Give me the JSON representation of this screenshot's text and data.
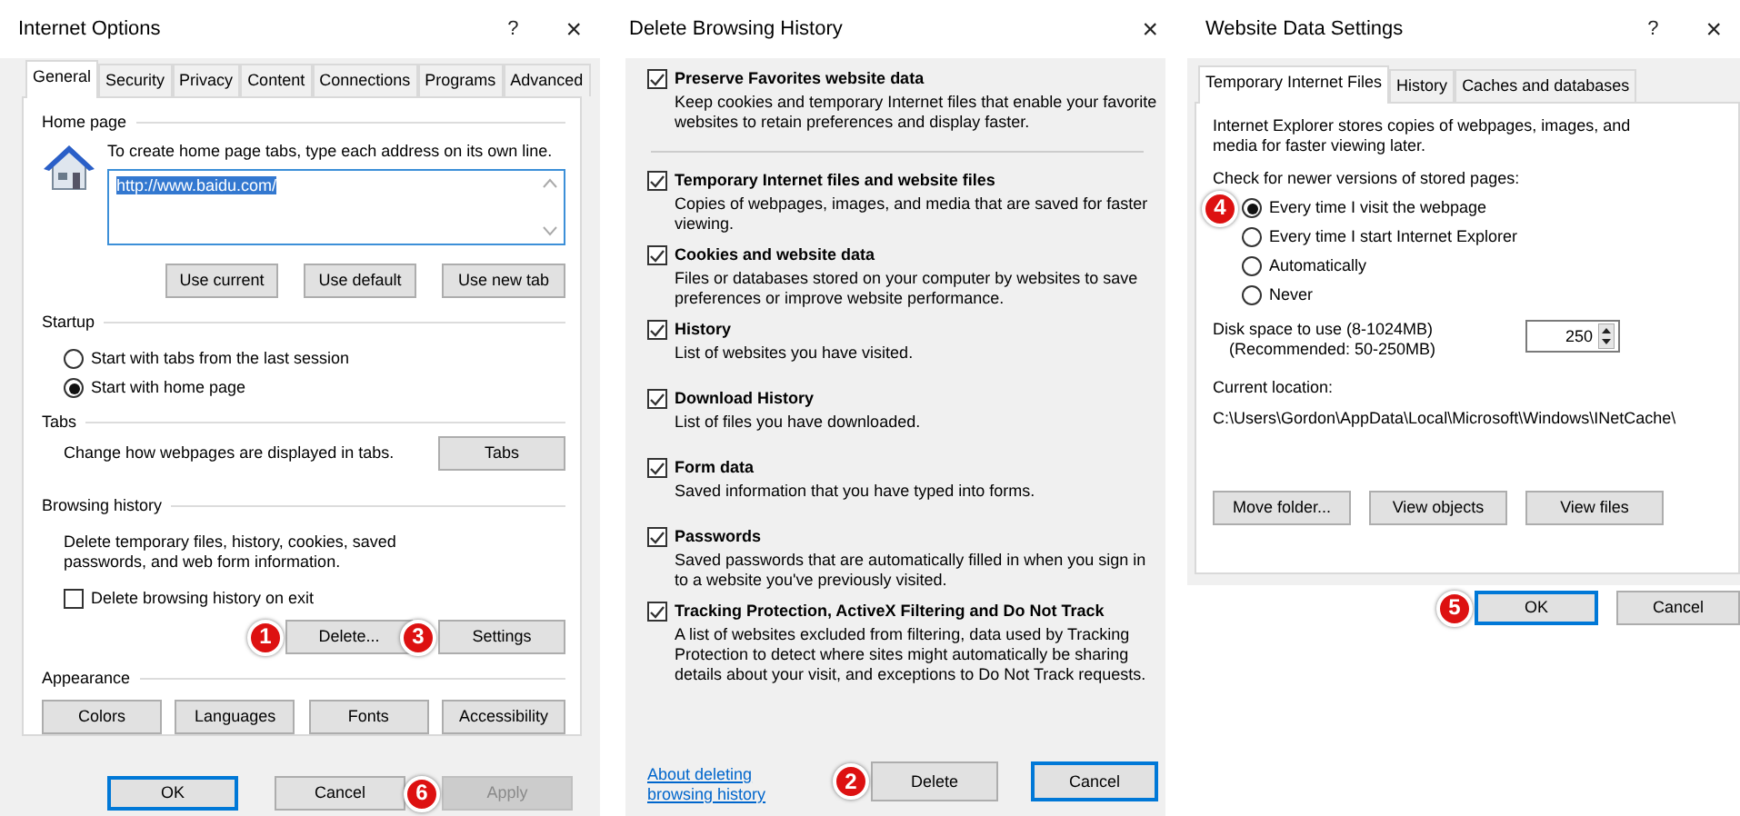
{
  "internet_options": {
    "title": "Internet Options",
    "help": "?",
    "close": "×",
    "tabs": [
      {
        "label": "General",
        "selected": true
      },
      {
        "label": "Security",
        "selected": false
      },
      {
        "label": "Privacy",
        "selected": false
      },
      {
        "label": "Content",
        "selected": false
      },
      {
        "label": "Connections",
        "selected": false
      },
      {
        "label": "Programs",
        "selected": false
      },
      {
        "label": "Advanced",
        "selected": false
      }
    ],
    "home_page": {
      "heading": "Home page",
      "instruction": "To create home page tabs, type each address on its own line.",
      "address": "http://www.baidu.com/",
      "buttons": [
        "Use current",
        "Use default",
        "Use new tab"
      ]
    },
    "startup": {
      "heading": "Startup",
      "options": [
        {
          "label": "Start with tabs from the last session",
          "selected": false
        },
        {
          "label": "Start with home page",
          "selected": true
        }
      ]
    },
    "tabs_section": {
      "heading": "Tabs",
      "description": "Change how webpages are displayed in tabs.",
      "button": "Tabs"
    },
    "browsing_history": {
      "heading": "Browsing history",
      "description": "Delete temporary files, history, cookies, saved passwords, and web form information.",
      "checkbox": {
        "label": "Delete browsing history on exit",
        "checked": false
      },
      "buttons": [
        {
          "label": "Delete...",
          "step": "1"
        },
        {
          "label": "Settings",
          "step": "3"
        }
      ]
    },
    "appearance": {
      "heading": "Appearance",
      "buttons": [
        "Colors",
        "Languages",
        "Fonts",
        "Accessibility"
      ]
    },
    "footer_buttons": [
      {
        "label": "OK",
        "default": true,
        "disabled": false
      },
      {
        "label": "Cancel",
        "default": false,
        "disabled": false
      },
      {
        "label": "Apply",
        "default": false,
        "disabled": true,
        "step": "6"
      }
    ]
  },
  "delete_history": {
    "title": "Delete Browsing History",
    "close": "×",
    "items": [
      {
        "title": "Preserve Favorites website data",
        "description": "Keep cookies and temporary Internet files that enable your favorite websites to retain preferences and display faster.",
        "checked": true,
        "separated": true
      },
      {
        "title": "Temporary Internet files and website files",
        "description": "Copies of webpages, images, and media that are saved for faster viewing.",
        "checked": true,
        "separated": false
      },
      {
        "title": "Cookies and website data",
        "description": "Files or databases stored on your computer by websites to save preferences or improve website performance.",
        "checked": true,
        "separated": false
      },
      {
        "title": "History",
        "description": "List of websites you have visited.",
        "checked": true,
        "separated": false
      },
      {
        "title": "Download History",
        "description": "List of files you have downloaded.",
        "checked": true,
        "separated": false
      },
      {
        "title": "Form data",
        "description": "Saved information that you have typed into forms.",
        "checked": true,
        "separated": false
      },
      {
        "title": "Passwords",
        "description": "Saved passwords that are automatically filled in when you sign in to a website you've previously visited.",
        "checked": true,
        "separated": false
      },
      {
        "title": "Tracking Protection, ActiveX Filtering and Do Not Track",
        "description": "A list of websites excluded from filtering, data used by Tracking Protection to detect where sites might automatically be sharing details about your visit, and exceptions to Do Not Track requests.",
        "checked": true,
        "separated": false
      }
    ],
    "link": "About deleting browsing history",
    "buttons": [
      {
        "label": "Delete",
        "default": false,
        "step": "2"
      },
      {
        "label": "Cancel",
        "default": true
      }
    ]
  },
  "website_data": {
    "title": "Website Data Settings",
    "help": "?",
    "close": "×",
    "tabs": [
      {
        "label": "Temporary Internet Files",
        "selected": true
      },
      {
        "label": "History",
        "selected": false
      },
      {
        "label": "Caches and databases",
        "selected": false
      }
    ],
    "intro": "Internet Explorer stores copies of webpages, images, and media for faster viewing later.",
    "check_label": "Check for newer versions of stored pages:",
    "options": [
      {
        "label": "Every time I visit the webpage",
        "selected": true,
        "step": "4"
      },
      {
        "label": "Every time I start Internet Explorer",
        "selected": false
      },
      {
        "label": "Automatically",
        "selected": false
      },
      {
        "label": "Never",
        "selected": false
      }
    ],
    "disk_label": "Disk space to use (8-1024MB)",
    "recommended": "(Recommended: 50-250MB)",
    "disk_value": "250",
    "location_label": "Current location:",
    "location_path": "C:\\Users\\Gordon\\AppData\\Local\\Microsoft\\Windows\\INetCache\\",
    "buttons": [
      "Move folder...",
      "View objects",
      "View files"
    ],
    "footer_buttons": [
      {
        "label": "OK",
        "default": true,
        "step": "5"
      },
      {
        "label": "Cancel",
        "default": false
      }
    ]
  }
}
